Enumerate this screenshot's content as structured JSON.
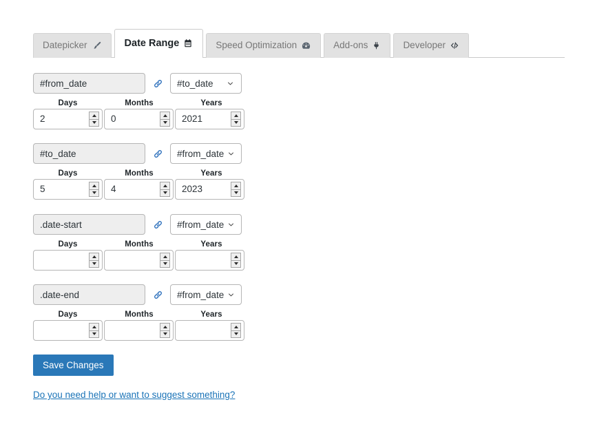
{
  "tabs": [
    {
      "label": "Datepicker",
      "icon": "paintbrush-icon",
      "active": false
    },
    {
      "label": "Date Range",
      "icon": "calendar-icon",
      "active": true
    },
    {
      "label": "Speed Optimization",
      "icon": "gauge-icon",
      "active": false
    },
    {
      "label": "Add-ons",
      "icon": "plug-icon",
      "active": false
    },
    {
      "label": "Developer",
      "icon": "code-icon",
      "active": false
    }
  ],
  "columns": {
    "days": "Days",
    "months": "Months",
    "years": "Years"
  },
  "link_icon_color": "#2a6ebb",
  "accent_color": "#2a78b8",
  "link_text_color": "#1a73b7",
  "rules": [
    {
      "selector": "#from_date",
      "link_icon": "chain-link-icon",
      "target": "#to_date",
      "days": "2",
      "months": "0",
      "years": "2021"
    },
    {
      "selector": "#to_date",
      "link_icon": "chain-link-icon",
      "target": "#from_date",
      "days": "5",
      "months": "4",
      "years": "2023"
    },
    {
      "selector": ".date-start",
      "link_icon": "chain-link-icon",
      "target": "#from_date",
      "days": "",
      "months": "",
      "years": ""
    },
    {
      "selector": ".date-end",
      "link_icon": "chain-link-icon",
      "target": "#from_date",
      "days": "",
      "months": "",
      "years": ""
    }
  ],
  "footer": {
    "save_label": "Save Changes",
    "help_link": "Do you need help or want to suggest something?"
  }
}
